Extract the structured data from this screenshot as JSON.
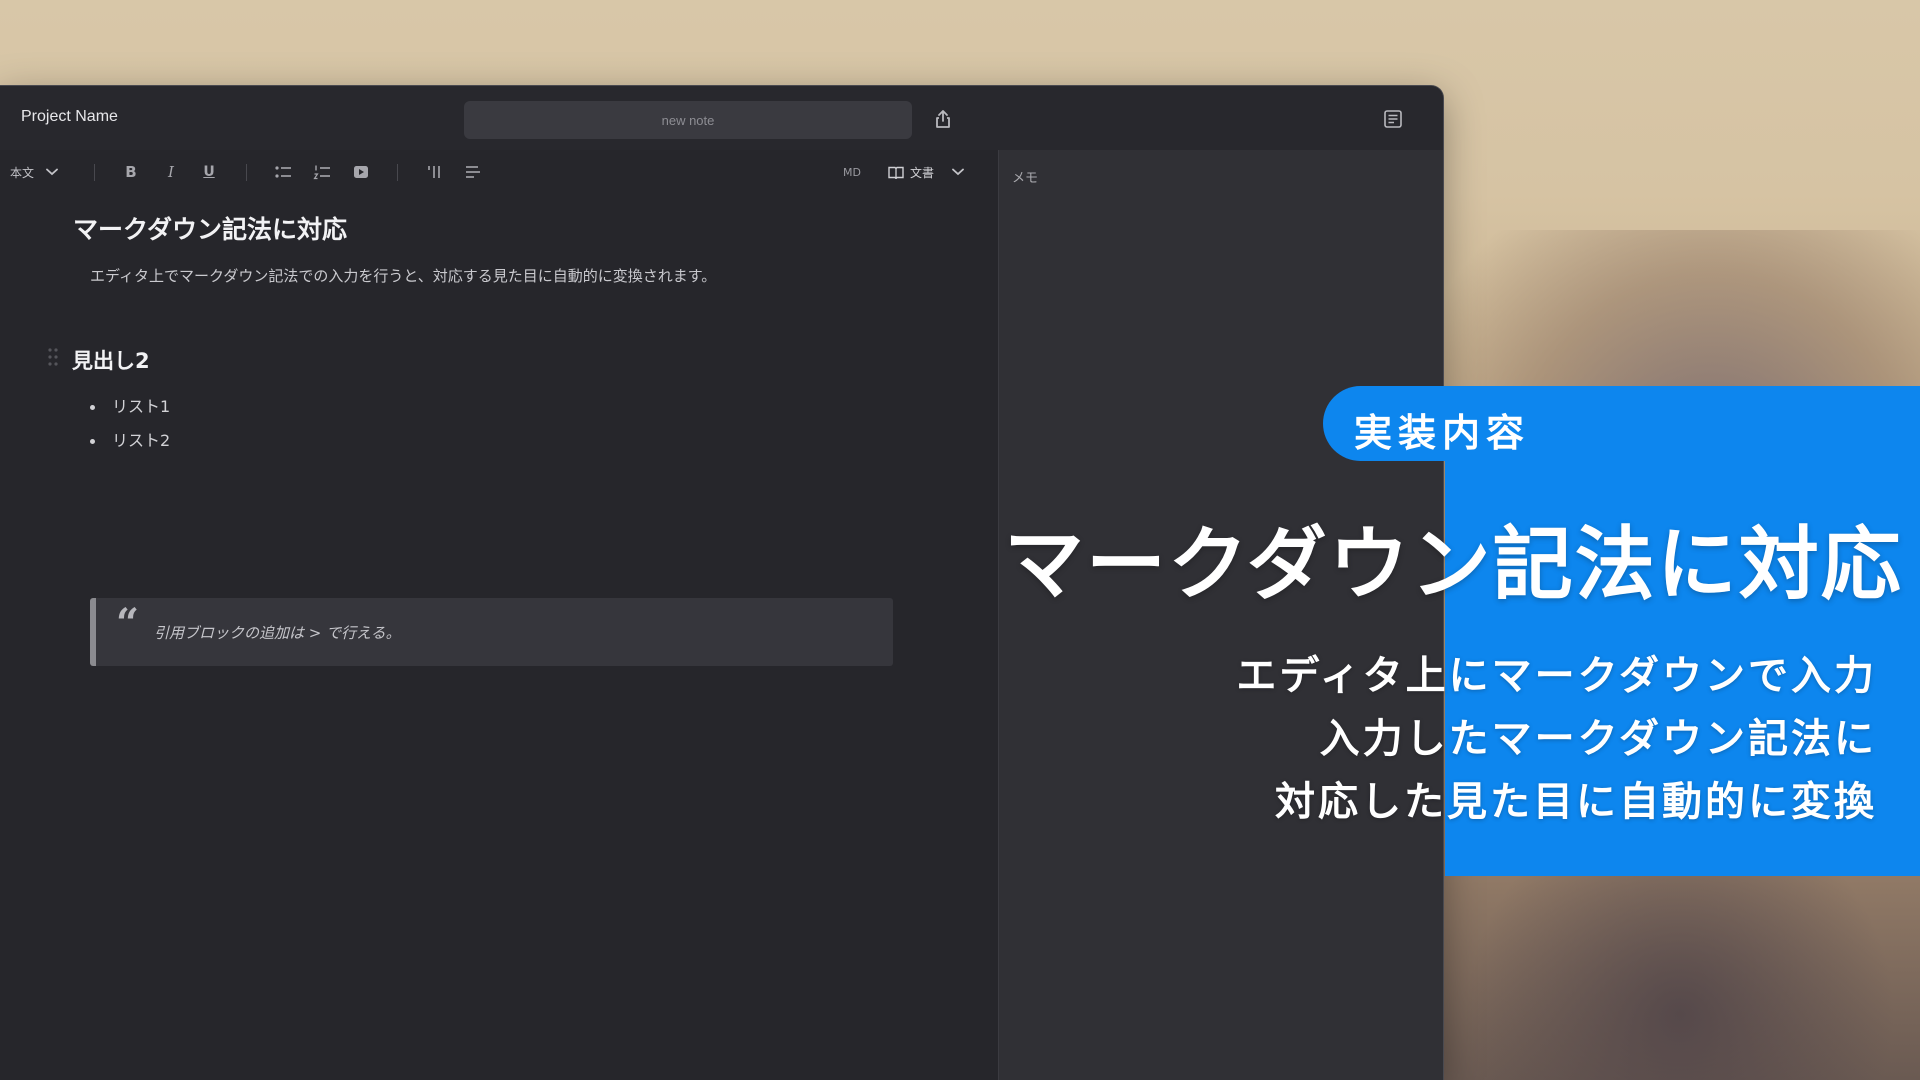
{
  "window": {
    "project_name": "Project Name",
    "note_placeholder": "new note",
    "share_icon": "share-icon",
    "panel_icon": "document-panel-icon"
  },
  "toolbar": {
    "style_select": "本文",
    "bold": "B",
    "italic": "I",
    "underline": "U",
    "md_label": "MD",
    "view_select": "文書"
  },
  "editor": {
    "heading1": "マークダウン記法に対応",
    "paragraph": "エディタ上でマークダウン記法での入力を行うと、対応する見た目に自動的に変換されます。",
    "heading2": "見出し2",
    "list_items": [
      "リスト1",
      "リスト2"
    ],
    "quote_mark": "“",
    "quote_text": "引用ブロックの追加は > で行える。"
  },
  "memo": {
    "label": "メモ"
  },
  "promo": {
    "badge": "実装内容",
    "headline": "マークダウン記法に対応",
    "lines": [
      "エディタ上にマークダウンで入力",
      "入力したマークダウン記法に",
      "対応した見た目に自動的に変換"
    ],
    "accent_color": "#0d86ee"
  }
}
